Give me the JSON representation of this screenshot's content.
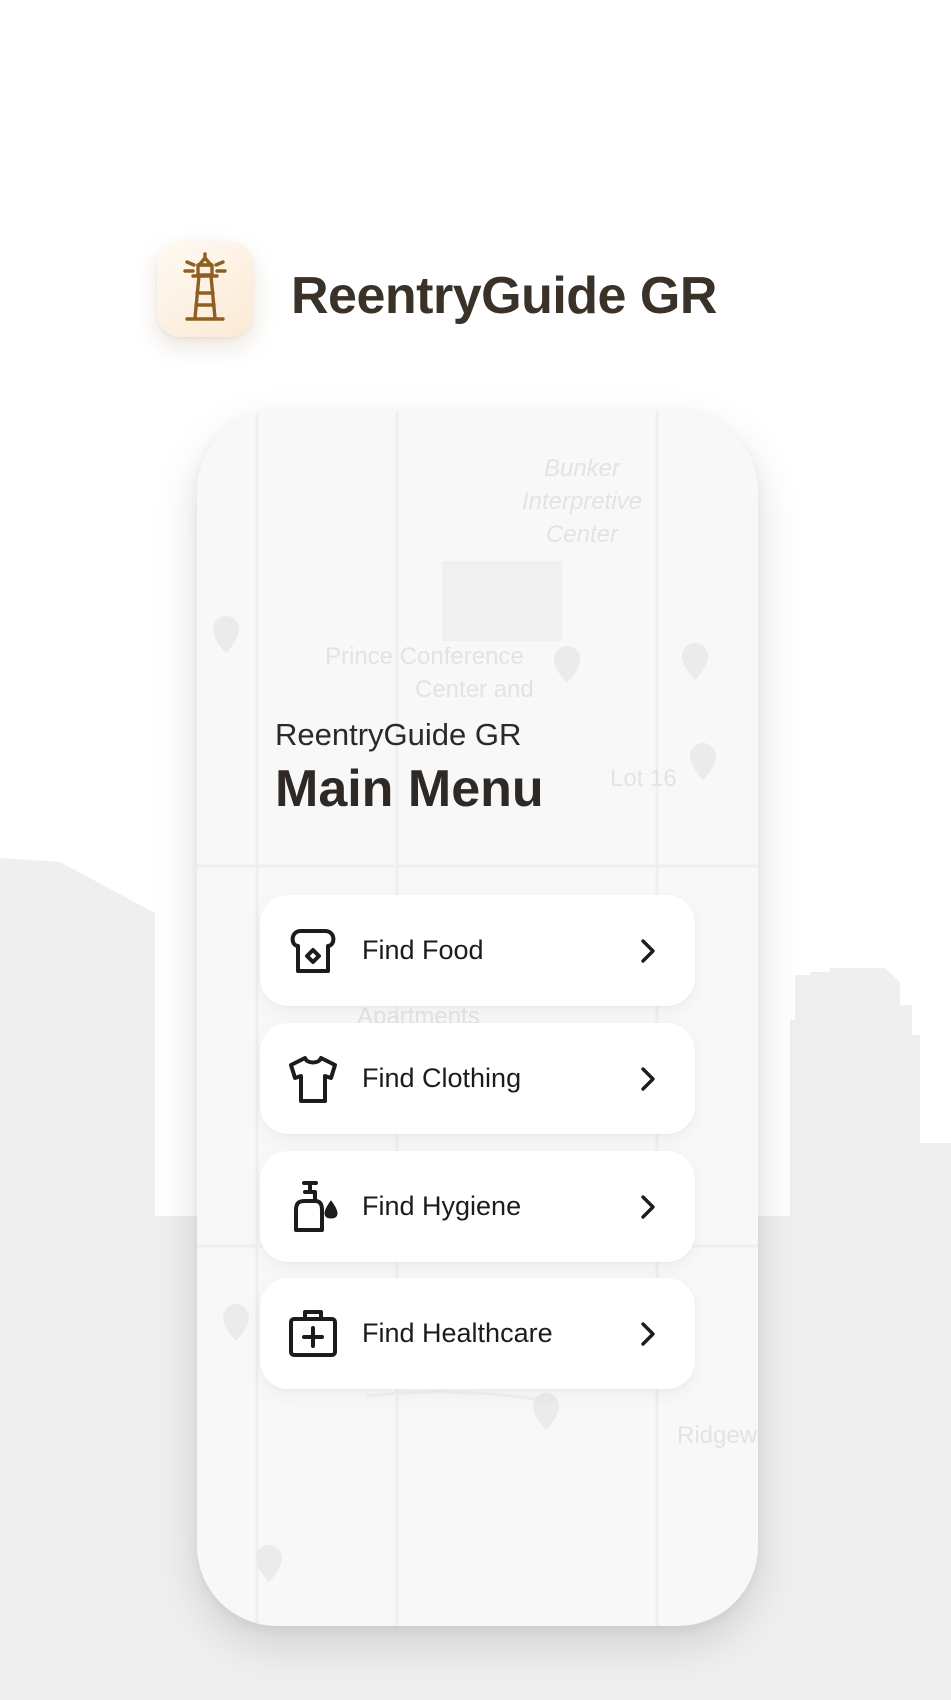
{
  "app": {
    "name": "ReentryGuide GR",
    "icon": "lighthouse-icon",
    "accent_color": "#8f5f22"
  },
  "screen": {
    "subtitle": "ReentryGuide GR",
    "title": "Main Menu"
  },
  "map": {
    "labels": [
      "Bunker",
      "Interpretive",
      "Center",
      "Prince Conference",
      "Center and",
      "Lot 16",
      "Apartments",
      "Ridgew"
    ]
  },
  "menu": {
    "items": [
      {
        "label": "Find Food",
        "icon": "bread-icon"
      },
      {
        "label": "Find Clothing",
        "icon": "shirt-icon"
      },
      {
        "label": "Find Hygiene",
        "icon": "soap-dispenser-icon"
      },
      {
        "label": "Find Healthcare",
        "icon": "first-aid-kit-icon"
      }
    ],
    "chevron_icon": "chevron-right-icon"
  },
  "colors": {
    "background": "#ffffff",
    "skyline": "#efefef",
    "card": "#ffffff",
    "text": "#2f2925"
  }
}
